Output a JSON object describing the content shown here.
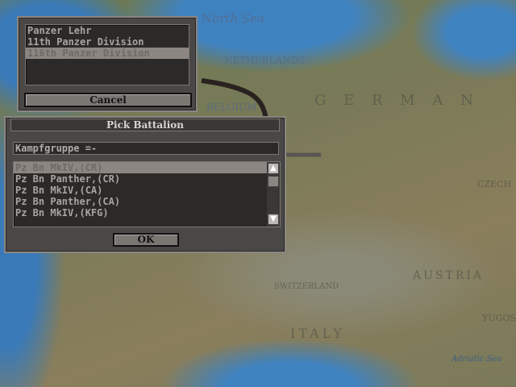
{
  "map": {
    "labels": [
      "North Sea",
      "NETHERLANDS",
      "BELGIUM",
      "G E R M A N",
      "CZECH",
      "AUSTRIA",
      "SWITZERLAND",
      "ITALY",
      "YUGOS",
      "Adriatic Sea"
    ]
  },
  "division_dialog": {
    "items": [
      "Panzer Lehr",
      "11th Panzer Division",
      "116th Panzer Division"
    ],
    "selected_index": 2,
    "cancel_label": "Cancel"
  },
  "battalion_dialog": {
    "title": "Pick Battalion",
    "group_label": "Kampfgruppe =-",
    "items": [
      "Pz Bn MkIV,(CR)",
      "Pz Bn Panther,(CR)",
      "Pz Bn MkIV,(CA)",
      "Pz Bn Panther,(CA)",
      "Pz Bn MkIV,(KFG)"
    ],
    "selected_index": 0,
    "ok_label": "OK"
  }
}
